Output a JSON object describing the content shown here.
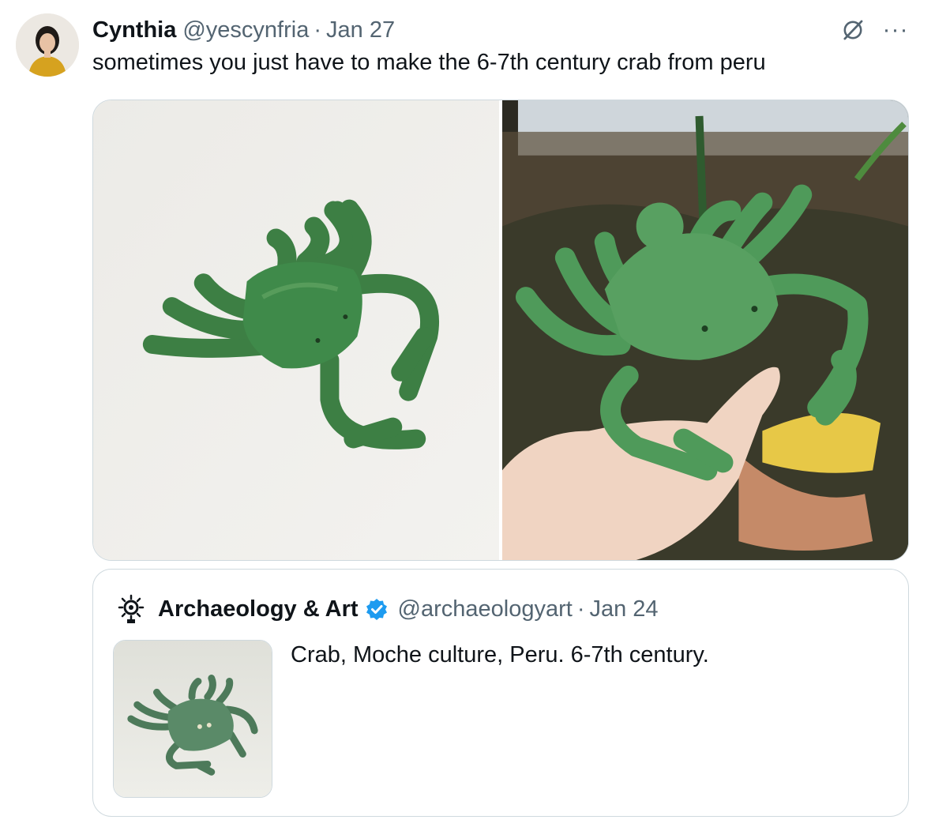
{
  "tweet": {
    "author_name": "Cynthia",
    "author_handle": "@yescynfria",
    "separator": "·",
    "date": "Jan 27",
    "text": "sometimes you just have to make the 6-7th century crab from peru",
    "icons": {
      "avatar": "avatar-photo",
      "grok": "grok-icon",
      "more": "more-options-icon"
    },
    "more_label": "···",
    "media": [
      {
        "description_icon": "green-clay-crab-on-white-photo"
      },
      {
        "description_icon": "green-clay-crab-in-hand-photo"
      }
    ]
  },
  "quote": {
    "author_name": "Archaeology & Art",
    "author_handle": "@archaeologyart",
    "separator": "·",
    "date": "Jan 24",
    "text": "Crab, Moche culture, Peru. 6-7th century.",
    "icons": {
      "logo": "sun-emblem-logo",
      "verified": "verified-badge-icon",
      "thumbnail": "bronze-crab-artifact-photo"
    }
  },
  "colors": {
    "text_primary": "#0f1419",
    "text_secondary": "#536471",
    "border": "#cfd9de",
    "verified_blue": "#1d9bf0",
    "crab_green": "#3f8a4a"
  }
}
